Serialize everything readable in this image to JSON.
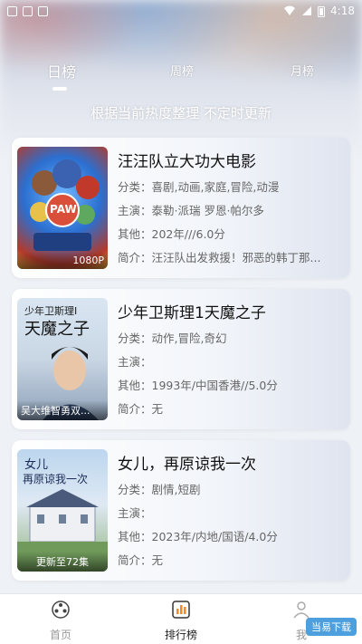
{
  "status_bar": {
    "time": "4:18"
  },
  "tabs": [
    {
      "label": "日榜",
      "active": true
    },
    {
      "label": "周榜",
      "active": false
    },
    {
      "label": "月榜",
      "active": false
    }
  ],
  "subtitle": "根据当前热度整理 不定时更新",
  "cards": [
    {
      "title": "汪汪队立大功大电影",
      "genre": "分类：喜剧,动画,家庭,冒险,动漫",
      "cast": "主演：泰勒·派瑞 罗恩·帕尔多",
      "other": "其他：202年///6.0分",
      "intro": "简介：汪汪队出发救援！邪恶的韩丁那...",
      "poster_caption": "1080P",
      "poster_text": "PAW"
    },
    {
      "title": "少年卫斯理1天魔之子",
      "genre": "分类：动作,冒险,奇幻",
      "cast": "主演：",
      "other": "其他：1993年/中国香港//5.0分",
      "intro": "简介：无",
      "poster_caption": "吴大维智勇双...",
      "poster_text_top": "少年卫斯理I",
      "poster_text_main": "天魔之子"
    },
    {
      "title": "女儿，再原谅我一次",
      "genre": "分类：剧情,短剧",
      "cast": "主演：",
      "other": "其他：2023年/内地/国语/4.0分",
      "intro": "简介：无",
      "poster_caption": "更新至72集",
      "poster_text_top": "女儿",
      "poster_text_main": "再原谅我一次"
    }
  ],
  "bottom_nav": [
    {
      "label": "首页",
      "icon": "film-reel-icon",
      "active": false
    },
    {
      "label": "排行榜",
      "icon": "ranking-icon",
      "active": true
    },
    {
      "label": "我",
      "icon": "profile-icon",
      "active": false
    }
  ],
  "watermark": "当易下载",
  "colors": {
    "accent": "#f08a24",
    "text_primary": "#111111",
    "text_secondary": "#666666"
  }
}
